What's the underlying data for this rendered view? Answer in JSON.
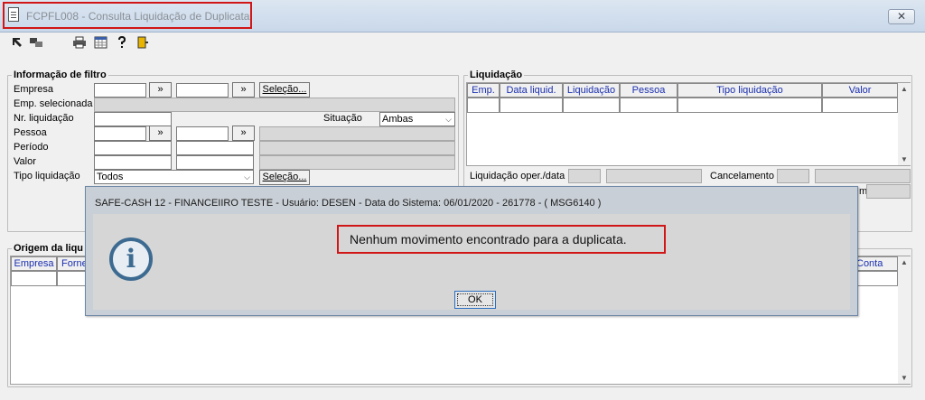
{
  "window": {
    "title": "FCPFL008 - Consulta Liquidação de Duplicata",
    "close_label": "✕"
  },
  "toolbar": {
    "icons": [
      "arrow-first-icon",
      "arrow-record-icon",
      "printer-icon",
      "calendar-grid-icon",
      "help-icon",
      "exit-door-icon"
    ]
  },
  "filter": {
    "title": "Informação de filtro",
    "labels": {
      "empresa": "Empresa",
      "emp_selecionada": "Emp. selecionada",
      "nr_liquidacao": "Nr. liquidação",
      "pessoa": "Pessoa",
      "periodo": "Período",
      "valor": "Valor",
      "tipo_liquidacao": "Tipo liquidação",
      "situacao": "Situação"
    },
    "lookup_label": "»",
    "selecao_label": "Seleção...",
    "situacao_value": "Ambas",
    "tipo_value": "Todos"
  },
  "liquidacao": {
    "title": "Liquidação",
    "columns": [
      "Emp.",
      "Data liquid.",
      "Liquidação",
      "Pessoa",
      "Tipo liquidação",
      "Valor"
    ],
    "liq_oper_label": "Liquidação oper./data",
    "cancelamento_label": "Cancelamento",
    "trailing_m": "m"
  },
  "origem": {
    "title": "Origem da liqu",
    "columns_left": [
      "Empresa",
      "Forne"
    ],
    "column_right": "Conta"
  },
  "dialog": {
    "title": "SAFE-CASH 12 - FINANCEIIRO TESTE - Usuário: DESEN - Data do Sistema: 06/01/2020 - 261778 - ( MSG6140 )",
    "message": "Nenhum movimento encontrado para a duplicata.",
    "ok_label": "OK",
    "icon": "info-icon"
  },
  "colors": {
    "highlight": "#d01616",
    "grid_header_text": "#1a2fb0",
    "info_icon": "#3d6a91"
  }
}
